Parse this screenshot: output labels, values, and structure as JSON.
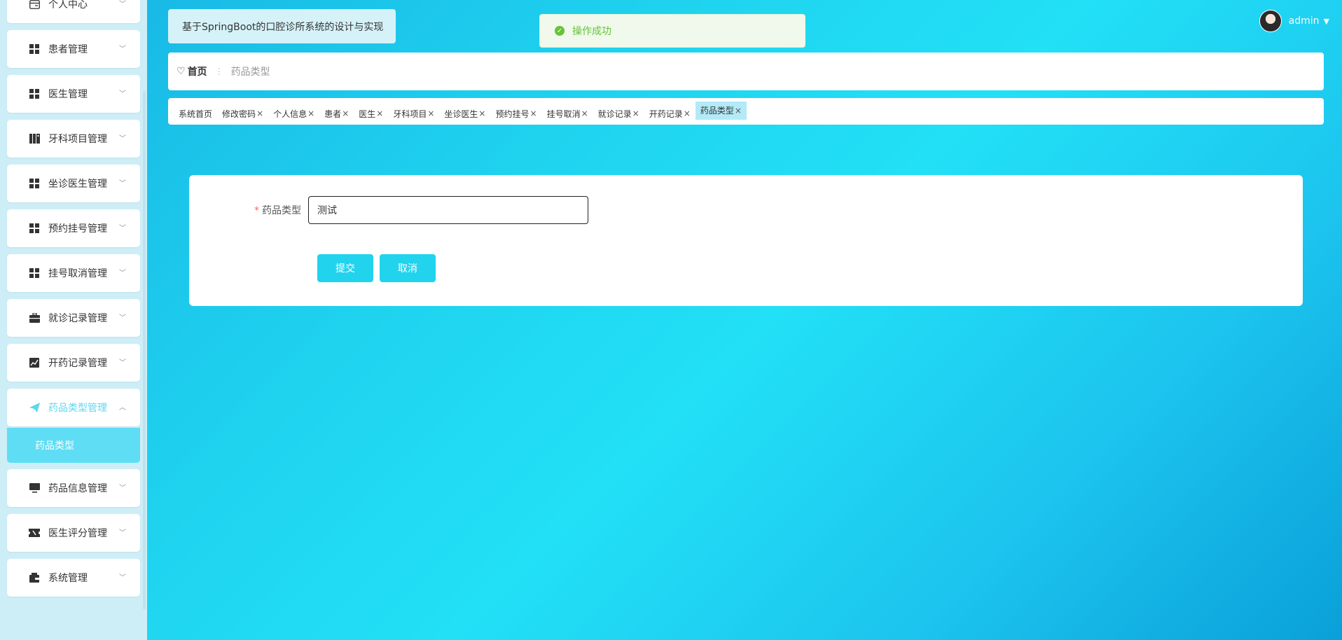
{
  "header": {
    "app_title": "基于SpringBoot的口腔诊所系统的设计与实现",
    "toast": "操作成功",
    "username": "admin"
  },
  "breadcrumb": {
    "home": "首页",
    "current": "药品类型"
  },
  "tags": [
    {
      "label": "系统首页",
      "closable": false
    },
    {
      "label": "修改密码",
      "closable": true
    },
    {
      "label": "个人信息",
      "closable": true
    },
    {
      "label": "患者",
      "closable": true
    },
    {
      "label": "医生",
      "closable": true
    },
    {
      "label": "牙科项目",
      "closable": true
    },
    {
      "label": "坐诊医生",
      "closable": true
    },
    {
      "label": "预约挂号",
      "closable": true
    },
    {
      "label": "挂号取消",
      "closable": true
    },
    {
      "label": "就诊记录",
      "closable": true
    },
    {
      "label": "开药记录",
      "closable": true
    },
    {
      "label": "药品类型",
      "closable": true,
      "active": true
    }
  ],
  "sidebar": {
    "items": [
      {
        "label": "个人中心",
        "icon": "card-icon"
      },
      {
        "label": "患者管理",
        "icon": "grid-icon"
      },
      {
        "label": "医生管理",
        "icon": "grid-icon"
      },
      {
        "label": "牙科项目管理",
        "icon": "book-icon"
      },
      {
        "label": "坐诊医生管理",
        "icon": "grid-icon"
      },
      {
        "label": "预约挂号管理",
        "icon": "grid-icon"
      },
      {
        "label": "挂号取消管理",
        "icon": "grid-icon"
      },
      {
        "label": "就诊记录管理",
        "icon": "briefcase-icon"
      },
      {
        "label": "开药记录管理",
        "icon": "chart-icon"
      },
      {
        "label": "药品类型管理",
        "icon": "send-icon",
        "active": true,
        "expanded": true,
        "submenu": [
          "药品类型"
        ]
      },
      {
        "label": "药品信息管理",
        "icon": "monitor-icon"
      },
      {
        "label": "医生评分管理",
        "icon": "ticket-icon"
      },
      {
        "label": "系统管理",
        "icon": "wallet-icon"
      }
    ]
  },
  "form": {
    "required_mark": "*",
    "field_label": "药品类型",
    "field_value": "测试",
    "submit_label": "提交",
    "cancel_label": "取消"
  },
  "colors": {
    "accent": "#22d3ee",
    "active_menu": "#5fddf4",
    "success": "#67c23a"
  }
}
